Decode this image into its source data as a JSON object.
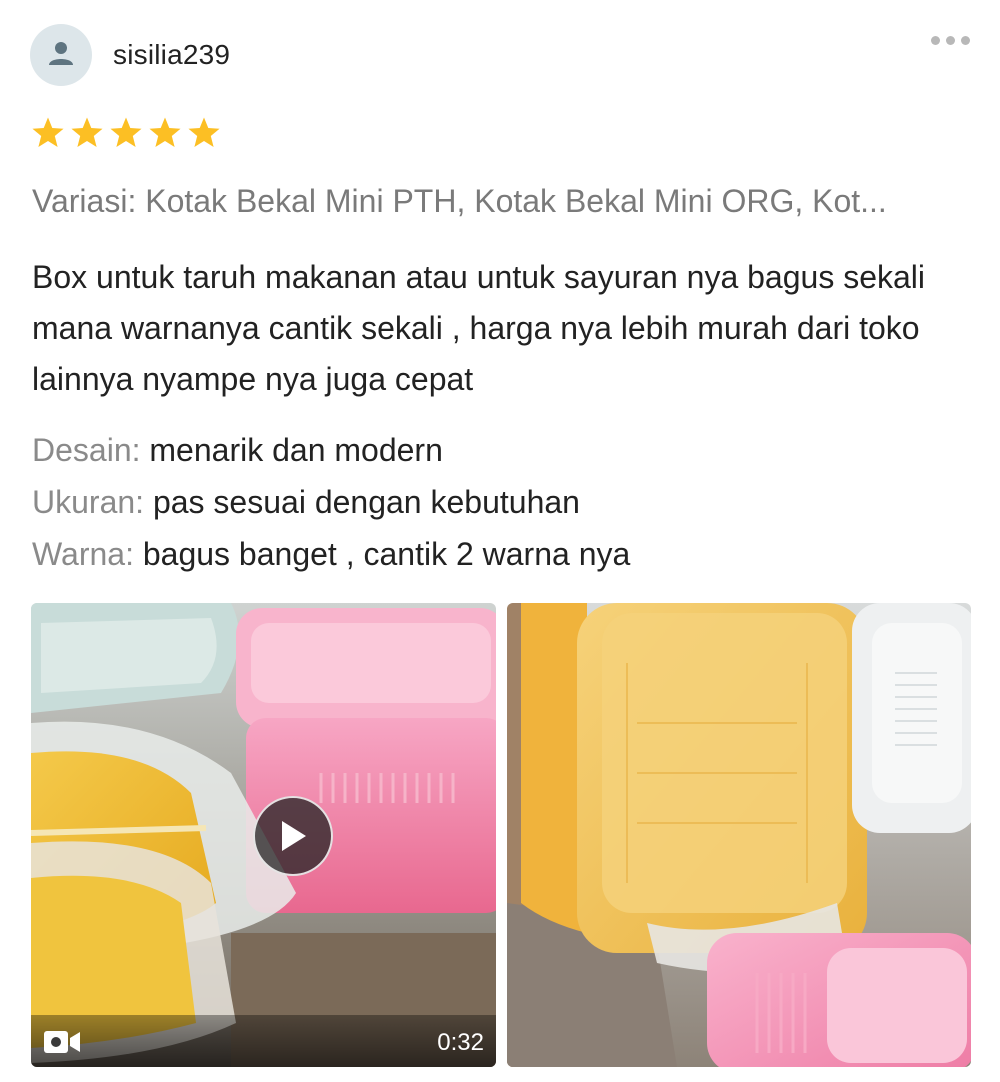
{
  "review": {
    "username": "sisilia239",
    "rating": 5,
    "rating_max": 5,
    "star_color": "#fcbf24",
    "variation": "Variasi: Kotak Bekal Mini PTH, Kotak Bekal Mini ORG, Kot...",
    "body": "Box untuk taruh makanan atau untuk sayuran nya bagus sekali mana warnanya cantik sekali , harga nya lebih murah dari toko lainnya nyampe nya juga cepat",
    "attributes": [
      {
        "label": "Desain:",
        "value": "menarik dan modern"
      },
      {
        "label": "Ukuran:",
        "value": "pas sesuai dengan kebutuhan"
      },
      {
        "label": "Warna:",
        "value": "bagus banget , cantik 2 warna nya"
      }
    ],
    "media": {
      "video": {
        "duration": "0:32",
        "icon": "video-camera-icon"
      },
      "image": {
        "icon": "photo"
      }
    }
  },
  "icons": {
    "avatar": "user-icon",
    "menu": "more-icon",
    "play": "play-icon"
  }
}
